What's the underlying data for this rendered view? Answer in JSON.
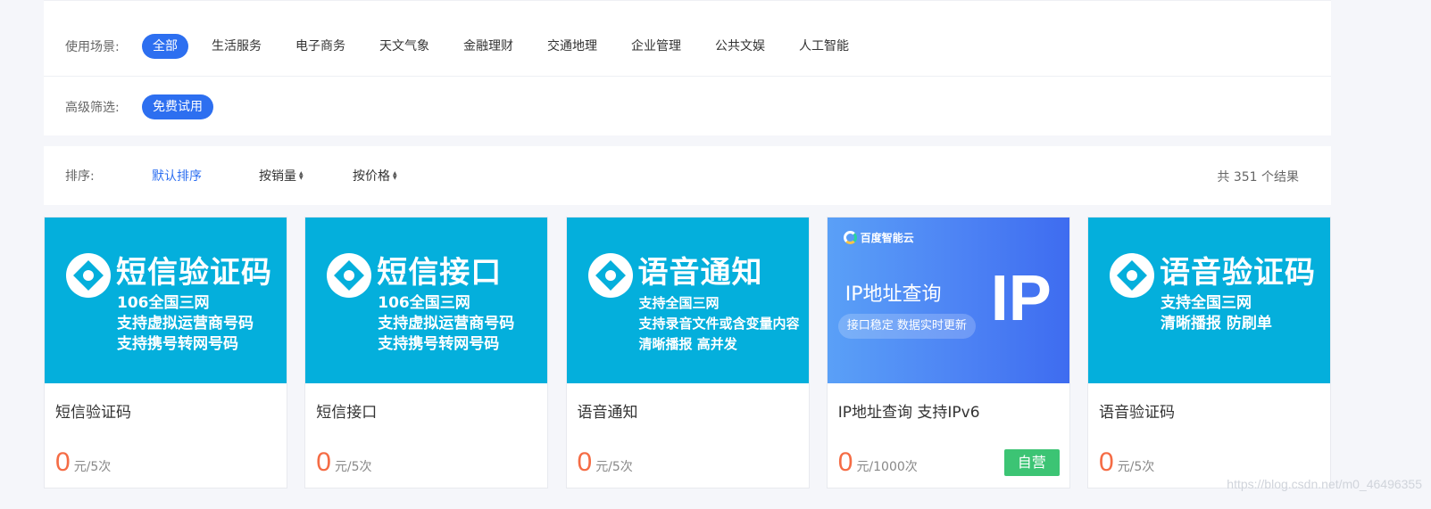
{
  "filters": {
    "scene_label": "使用场景:",
    "scenes": [
      "全部",
      "生活服务",
      "电子商务",
      "天文气象",
      "金融理财",
      "交通地理",
      "企业管理",
      "公共文娱",
      "人工智能"
    ],
    "active_scene": "全部",
    "advanced_label": "高级筛选:",
    "advanced": [
      "免费试用"
    ]
  },
  "sort": {
    "label": "排序:",
    "default": "默认排序",
    "by_sales": "按销量",
    "by_price": "按价格",
    "total": "共 351 个结果"
  },
  "cards": [
    {
      "banner_title": "短信验证码",
      "banner_lines": [
        "106全国三网",
        "支持虚拟运营商号码",
        "支持携号转网号码"
      ],
      "name": "短信验证码",
      "price": "0",
      "unit": "元/5次"
    },
    {
      "banner_title": "短信接口",
      "banner_lines": [
        "106全国三网",
        "支持虚拟运营商号码",
        "支持携号转网号码"
      ],
      "name": "短信接口",
      "price": "0",
      "unit": "元/5次"
    },
    {
      "banner_title": "语音通知",
      "banner_lines": [
        "支持全国三网",
        "支持录音文件或含变量内容",
        "清晰播报 高并发"
      ],
      "name": "语音通知",
      "price": "0",
      "unit": "元/5次"
    },
    {
      "brand": "百度智能云",
      "banner_title": "IP地址查询",
      "tag": "接口稳定  数据实时更新",
      "big_text": "IP",
      "name": "IP地址查询 支持IPv6",
      "price": "0",
      "unit": "元/1000次",
      "badge": "自营"
    },
    {
      "banner_title": "语音验证码",
      "banner_lines": [
        "支持全国三网",
        "清晰播报 防刷单"
      ],
      "name": "语音验证码",
      "price": "0",
      "unit": "元/5次"
    }
  ],
  "watermark": "https://blog.csdn.net/m0_46496355",
  "colors": {
    "accent": "#2d6ff0",
    "banner": "#04afdc",
    "price": "#f56c45",
    "badge": "#3cc474"
  }
}
